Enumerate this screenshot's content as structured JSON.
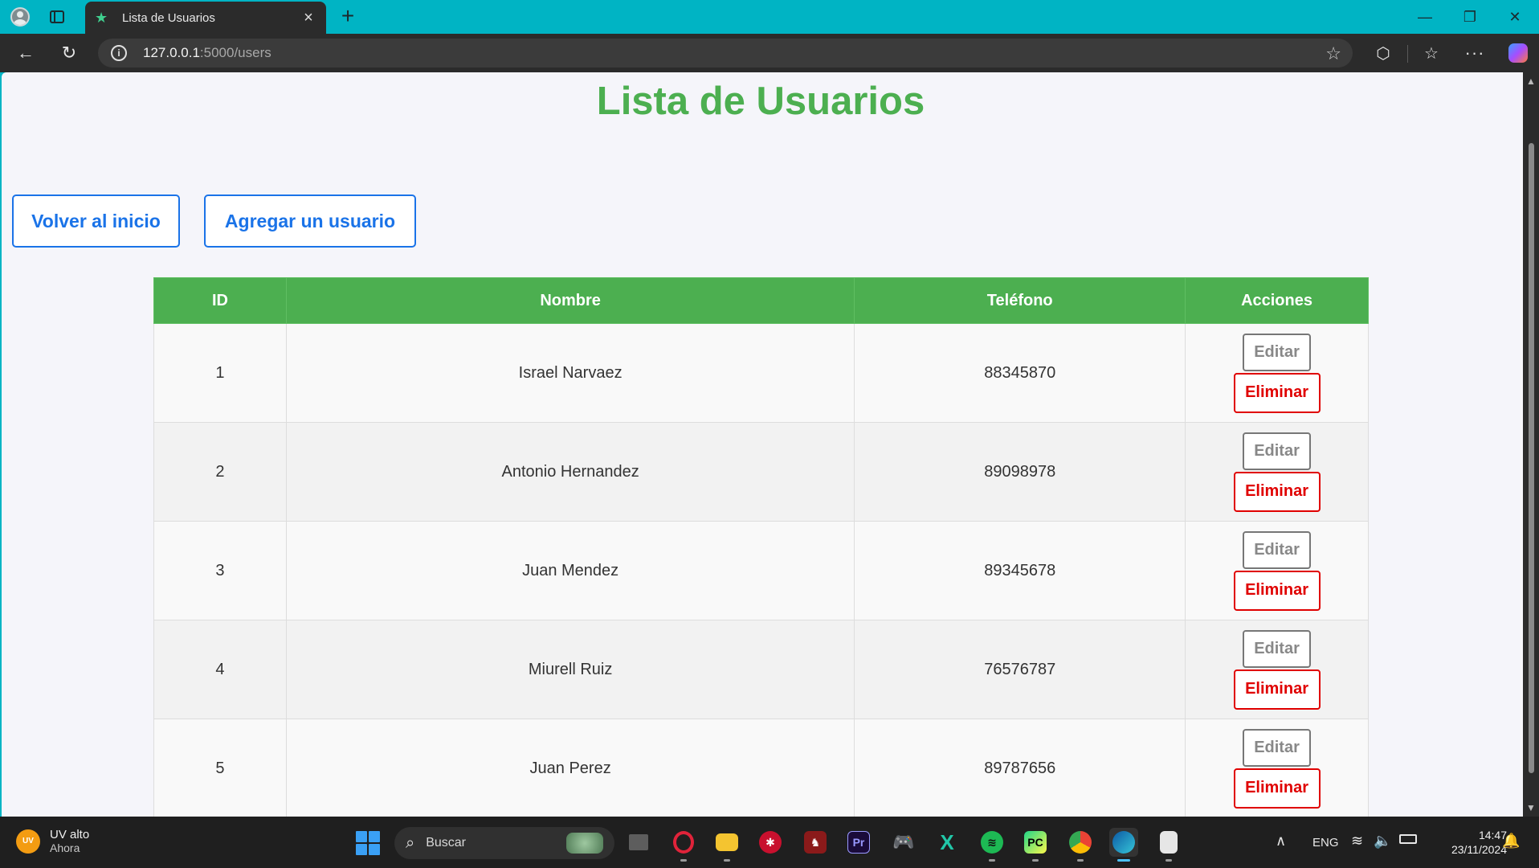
{
  "browser": {
    "tab_title": "Lista de Usuarios",
    "url_host": "127.0.0.1",
    "url_path": ":5000/users",
    "accent": "#00b4c4"
  },
  "page": {
    "title": "Lista de Usuarios",
    "btn_home": "Volver al inicio",
    "btn_add": "Agregar un usuario",
    "title_color": "#4caf50",
    "link_color": "#1a73e8"
  },
  "table": {
    "headers": {
      "id": "ID",
      "name": "Nombre",
      "phone": "Teléfono",
      "actions": "Acciones"
    },
    "edit_label": "Editar",
    "delete_label": "Eliminar",
    "rows": [
      {
        "id": "1",
        "name": "Israel Narvaez",
        "phone": "88345870"
      },
      {
        "id": "2",
        "name": "Antonio Hernandez",
        "phone": "89098978"
      },
      {
        "id": "3",
        "name": "Juan Mendez",
        "phone": "89345678"
      },
      {
        "id": "4",
        "name": "Miurell Ruiz",
        "phone": "76576787"
      },
      {
        "id": "5",
        "name": "Juan Perez",
        "phone": "89787656"
      }
    ]
  },
  "taskbar": {
    "weather_title": "UV alto",
    "weather_sub": "Ahora",
    "weather_badge": "UV",
    "search_placeholder": "Buscar",
    "lang": "ENG",
    "time": "14:47",
    "date": "23/11/2024",
    "pycharm_label": "PC",
    "premiere_label": "Pr"
  }
}
